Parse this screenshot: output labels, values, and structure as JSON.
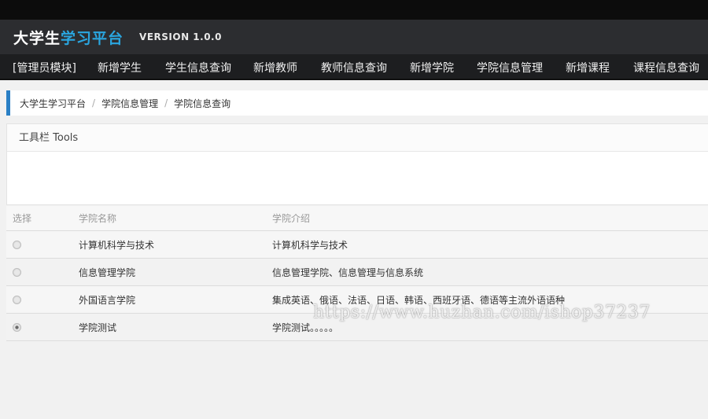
{
  "header": {
    "brand_part1": "大学生",
    "brand_part2": "学习平台",
    "version": "VERSION 1.0.0"
  },
  "nav": {
    "items": [
      {
        "label": "[管理员模块]"
      },
      {
        "label": "新增学生"
      },
      {
        "label": "学生信息查询"
      },
      {
        "label": "新增教师"
      },
      {
        "label": "教师信息查询"
      },
      {
        "label": "新增学院"
      },
      {
        "label": "学院信息管理"
      },
      {
        "label": "新增课程"
      },
      {
        "label": "课程信息查询"
      }
    ]
  },
  "breadcrumb": {
    "items": [
      "大学生学习平台",
      "学院信息管理",
      "学院信息查询"
    ],
    "separator": "/"
  },
  "toolbar": {
    "title": "工具栏 Tools"
  },
  "table": {
    "headers": [
      "选择",
      "学院名称",
      "学院介绍"
    ],
    "rows": [
      {
        "name": "计算机科学与技术",
        "intro": "计算机科学与技术",
        "selected": false
      },
      {
        "name": "信息管理学院",
        "intro": "信息管理学院、信息管理与信息系统",
        "selected": false
      },
      {
        "name": "外国语言学院",
        "intro": "集成英语、俄语、法语、日语、韩语、西班牙语、德语等主流外语语种",
        "selected": false
      },
      {
        "name": "学院测试",
        "intro": "学院测试。。。。。",
        "selected": true
      }
    ]
  },
  "watermark": "https://www.huzhan.com/ishop37237",
  "colors": {
    "header_bg": "#2c2d30",
    "nav_bg": "#1d1e20",
    "brand_accent": "#2aa6e0",
    "breadcrumb_accent": "#2a7fc5"
  }
}
